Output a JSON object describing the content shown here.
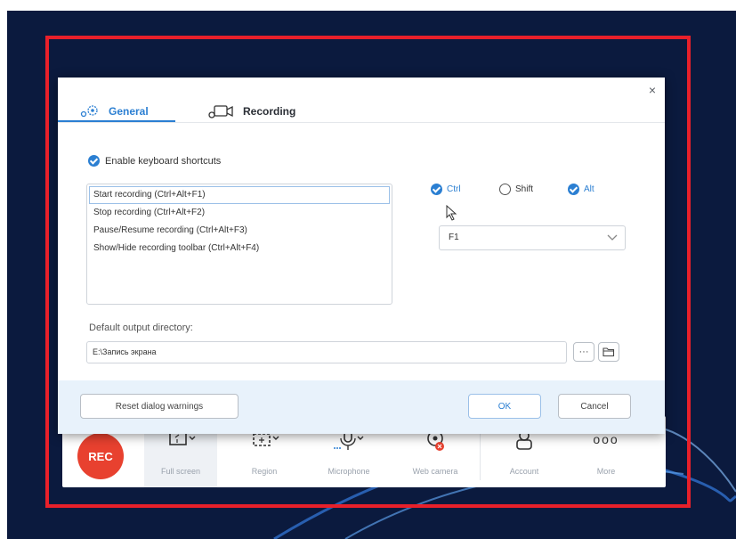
{
  "dialog": {
    "close_label": "×",
    "tabs": [
      {
        "label": "General",
        "icon": "gear-icon",
        "active": true
      },
      {
        "label": "Recording",
        "icon": "video-camera-icon",
        "active": false
      }
    ],
    "enable_shortcuts_label": "Enable keyboard shortcuts",
    "shortcuts": [
      "Start recording (Ctrl+Alt+F1)",
      "Stop recording (Ctrl+Alt+F2)",
      "Pause/Resume recording (Ctrl+Alt+F3)",
      "Show/Hide recording toolbar (Ctrl+Alt+F4)"
    ],
    "modifiers": {
      "ctrl": {
        "label": "Ctrl",
        "checked": true
      },
      "shift": {
        "label": "Shift",
        "checked": false
      },
      "alt": {
        "label": "Alt",
        "checked": true
      }
    },
    "key_select_value": "F1",
    "output_label": "Default output directory:",
    "output_value": "E:\\Запись экрана",
    "browse_label": "···",
    "reset_label": "Reset dialog warnings",
    "ok_label": "OK",
    "cancel_label": "Cancel"
  },
  "toolbar": {
    "rec_label": "REC",
    "items": [
      {
        "label": "Full screen",
        "icon": "fullscreen-icon"
      },
      {
        "label": "Region",
        "icon": "region-icon"
      },
      {
        "label": "Microphone",
        "icon": "microphone-icon"
      },
      {
        "label": "Web camera",
        "icon": "webcam-icon"
      },
      {
        "label": "Account",
        "icon": "account-icon"
      },
      {
        "label": "More",
        "icon": "more-icon"
      }
    ],
    "more_glyph": "ooo"
  },
  "colors": {
    "accent": "#2b7fd2",
    "rec": "#e8412f",
    "highlight_frame": "#e8202a",
    "desktop": "#0b1a3e",
    "footer": "#e8f2fb"
  }
}
